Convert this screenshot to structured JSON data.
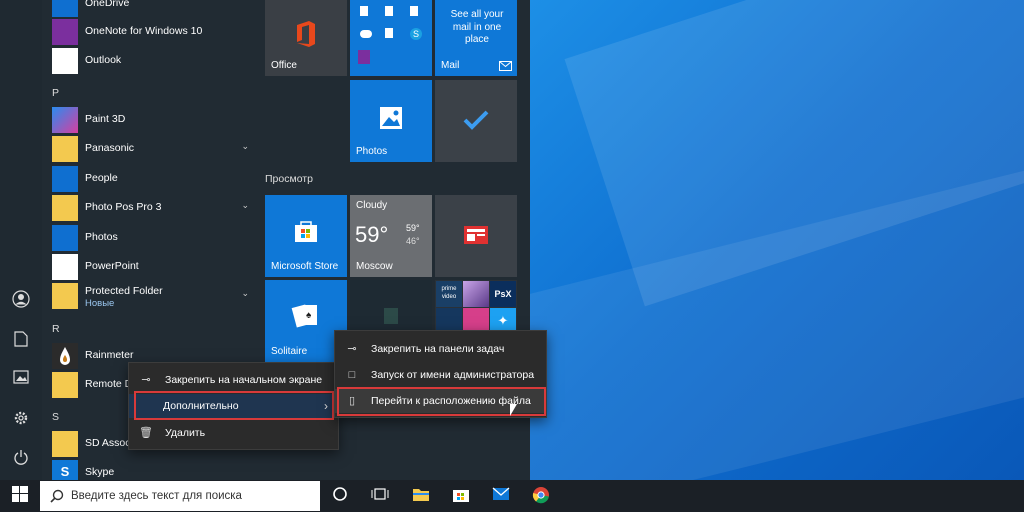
{
  "applist": {
    "onedrive": "OneDrive",
    "onenote": "OneNote for Windows 10",
    "outlook": "Outlook",
    "letter_p": "P",
    "paint3d": "Paint 3D",
    "panasonic": "Panasonic",
    "people": "People",
    "photopos": "Photo Pos Pro 3",
    "photos": "Photos",
    "powerpoint": "PowerPoint",
    "protected": "Protected Folder",
    "new_badge": "Новые",
    "letter_r": "R",
    "rainmeter": "Rainmeter",
    "remote": "Remote D",
    "letter_s": "S",
    "sd": "SD Associ",
    "skype": "Skype"
  },
  "tiles": {
    "office": "Office",
    "mail_text": "See all your mail in one place",
    "mail": "Mail",
    "photos": "Photos",
    "group": "Просмотр",
    "store": "Microsoft Store",
    "weather_cond": "Cloudy",
    "weather_temp": "59°",
    "weather_hi": "59°",
    "weather_lo": "46°",
    "weather_city": "Moscow",
    "solitaire": "Solitaire",
    "prime": "prime video",
    "psx": "PsX"
  },
  "menu1": {
    "pin_start": "Закрепить на начальном экране",
    "more": "Дополнительно",
    "remove": "Удалить"
  },
  "menu2": {
    "pin_taskbar": "Закрепить на панели задач",
    "run_admin": "Запуск от имени администратора",
    "open_location": "Перейти к расположению файла"
  },
  "taskbar": {
    "search_placeholder": "Введите здесь текст для поиска"
  }
}
